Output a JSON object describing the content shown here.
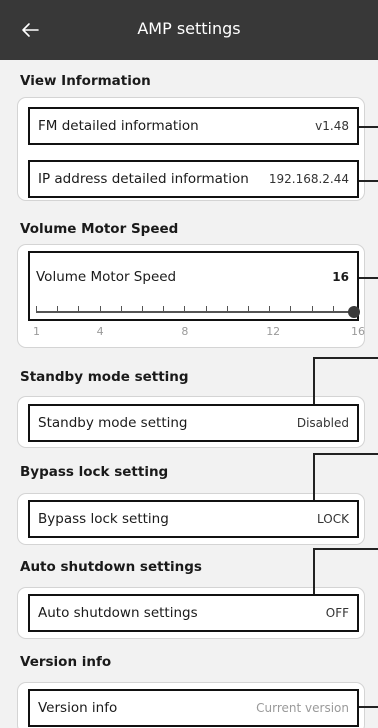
{
  "header": {
    "title": "AMP settings",
    "back_icon": "arrow-left-icon"
  },
  "sections": {
    "view_info": {
      "title": "View Information",
      "fm": {
        "label": "FM detailed information",
        "value": "v1.48"
      },
      "ip": {
        "label": "IP address detailed information",
        "value": "192.168.2.44"
      }
    },
    "volume": {
      "title": "Volume Motor Speed",
      "label": "Volume Motor Speed",
      "value": "16",
      "slider": {
        "min": 1,
        "max": 16,
        "current": 16,
        "ticks": [
          "1",
          "4",
          "8",
          "12",
          "16"
        ]
      }
    },
    "standby": {
      "title": "Standby mode setting",
      "label": "Standby mode setting",
      "value": "Disabled"
    },
    "bypass": {
      "title": "Bypass lock setting",
      "label": "Bypass lock setting",
      "value": "LOCK"
    },
    "shutdown": {
      "title": "Auto shutdown settings",
      "label": "Auto shutdown settings",
      "value": "OFF"
    },
    "version": {
      "title": "Version info",
      "label": "Version info",
      "value": "Current version"
    }
  },
  "colors": {
    "appbar": "#383838",
    "background": "#f2f2f2",
    "card": "#ffffff",
    "outline": "#111111"
  }
}
